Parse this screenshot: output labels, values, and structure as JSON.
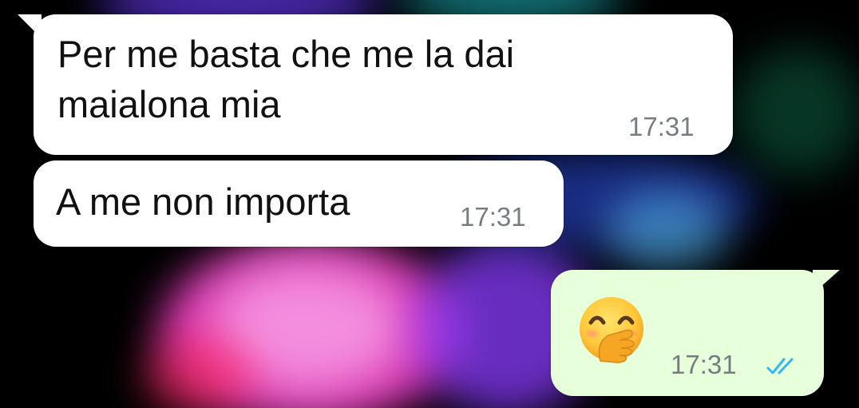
{
  "messages": [
    {
      "direction": "incoming",
      "text": "Per me basta che me la dai\nmaialona mia",
      "time": "17:31"
    },
    {
      "direction": "incoming",
      "text": "A me non importa",
      "time": "17:31"
    },
    {
      "direction": "outgoing",
      "emoji": "hand-over-mouth-smiling-emoji",
      "time": "17:31",
      "status": "read"
    }
  ],
  "colors": {
    "incoming_bubble": "#ffffff",
    "outgoing_bubble": "#e7ffdb",
    "timestamp": "#777c80",
    "read_ticks": "#34b7f1"
  }
}
